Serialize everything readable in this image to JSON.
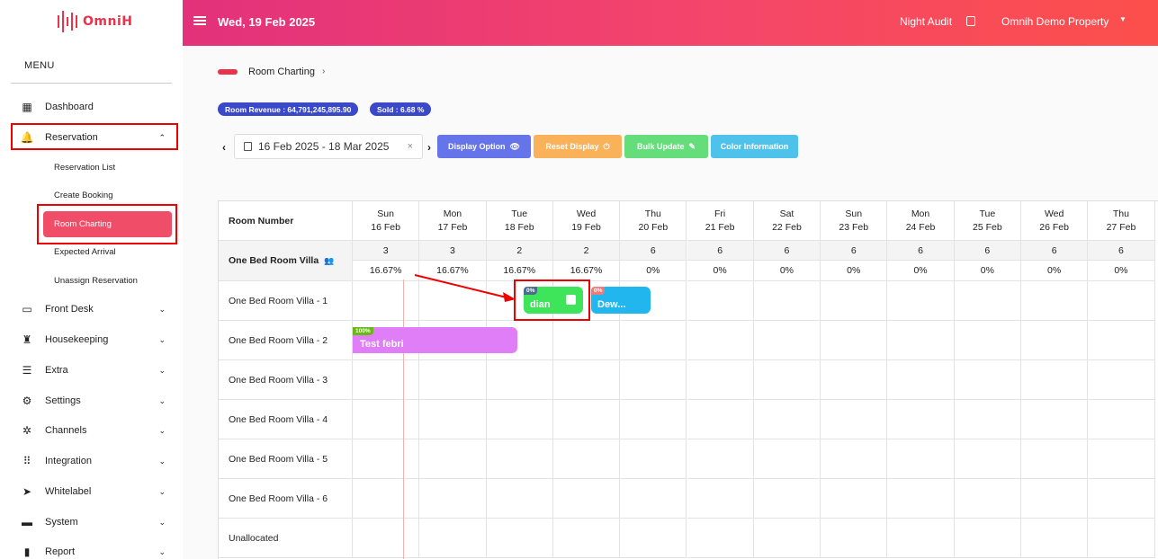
{
  "app": {
    "logo_text": "OmniH"
  },
  "sidebar": {
    "menu_title": "MENU",
    "items": [
      {
        "label": "Dashboard",
        "icon": "dashboard-icon",
        "chevron": ""
      },
      {
        "label": "Reservation",
        "icon": "bell-icon",
        "chevron": "⌃"
      },
      {
        "label": "Front Desk",
        "icon": "window-icon",
        "chevron": "⌄"
      },
      {
        "label": "Housekeeping",
        "icon": "broom-icon",
        "chevron": "⌄"
      },
      {
        "label": "Extra",
        "icon": "list-icon",
        "chevron": "⌄"
      },
      {
        "label": "Settings",
        "icon": "gear-icon",
        "chevron": "⌄"
      },
      {
        "label": "Channels",
        "icon": "network-icon",
        "chevron": "⌄"
      },
      {
        "label": "Integration",
        "icon": "grid-icon",
        "chevron": "⌄"
      },
      {
        "label": "Whitelabel",
        "icon": "tag-icon",
        "chevron": "⌄"
      },
      {
        "label": "System",
        "icon": "laptop-icon",
        "chevron": "⌄"
      },
      {
        "label": "Report",
        "icon": "file-icon",
        "chevron": "⌄"
      }
    ],
    "sub_items": [
      "Reservation List",
      "Create Booking",
      "Room Charting",
      "Expected Arrival",
      "Unassign Reservation"
    ]
  },
  "topbar": {
    "date": "Wed, 19 Feb 2025",
    "night_audit": "Night Audit",
    "property": "Omnih Demo Property"
  },
  "breadcrumb": {
    "label": "Room Charting",
    "arrow": "›"
  },
  "stats": {
    "room_revenue": "Room Revenue : 64,791,245,895.90",
    "sold": "Sold : 6.68 %"
  },
  "toolbar": {
    "prev": "‹",
    "next": "›",
    "date_range": "16 Feb 2025 - 18 Mar 2025",
    "clear": "×",
    "display_option": "Display Option",
    "reset_display": "Reset Display",
    "bulk_update": "Bulk Update",
    "color_information": "Color Information",
    "colors": {
      "display": "#6674e9",
      "reset": "#f9b15a",
      "bulk": "#65dd7b",
      "color_info": "#4fc2ec"
    }
  },
  "calendar": {
    "header_label": "Room Number",
    "days": [
      {
        "dow": "Sun",
        "date": "16 Feb",
        "avail": "3",
        "pct": "16.67%"
      },
      {
        "dow": "Mon",
        "date": "17 Feb",
        "avail": "3",
        "pct": "16.67%"
      },
      {
        "dow": "Tue",
        "date": "18 Feb",
        "avail": "2",
        "pct": "16.67%"
      },
      {
        "dow": "Wed",
        "date": "19 Feb",
        "avail": "2",
        "pct": "16.67%"
      },
      {
        "dow": "Thu",
        "date": "20 Feb",
        "avail": "6",
        "pct": "0%"
      },
      {
        "dow": "Fri",
        "date": "21 Feb",
        "avail": "6",
        "pct": "0%"
      },
      {
        "dow": "Sat",
        "date": "22 Feb",
        "avail": "6",
        "pct": "0%"
      },
      {
        "dow": "Sun",
        "date": "23 Feb",
        "avail": "6",
        "pct": "0%"
      },
      {
        "dow": "Mon",
        "date": "24 Feb",
        "avail": "6",
        "pct": "0%"
      },
      {
        "dow": "Tue",
        "date": "25 Feb",
        "avail": "6",
        "pct": "0%"
      },
      {
        "dow": "Wed",
        "date": "26 Feb",
        "avail": "6",
        "pct": "0%"
      },
      {
        "dow": "Thu",
        "date": "27 Feb",
        "avail": "6",
        "pct": "0%"
      }
    ],
    "room_type": "One Bed Room Villa",
    "rooms": [
      "One Bed Room Villa - 1",
      "One Bed Room Villa - 2",
      "One Bed Room Villa - 3",
      "One Bed Room Villa - 4",
      "One Bed Room Villa - 5",
      "One Bed Room Villa - 6",
      "Unallocated"
    ],
    "bookings": [
      {
        "guest": "dian",
        "progress": "0%",
        "color": "#3ee45a",
        "tag_color": "#4a6d8c"
      },
      {
        "guest": "Dew...",
        "progress": "0%",
        "color": "#22b6ee",
        "tag_color": "#f07a7a"
      },
      {
        "guest": "Test febri",
        "progress": "100%",
        "color": "#df7ef7",
        "tag_color": "#69b817"
      }
    ]
  }
}
